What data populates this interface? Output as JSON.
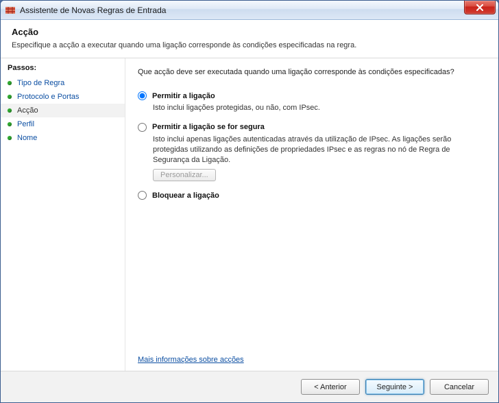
{
  "window": {
    "title": "Assistente de Novas Regras de Entrada"
  },
  "header": {
    "title": "Acção",
    "subtitle": "Especifique a acção a executar quando uma ligação corresponde às condições especificadas na regra."
  },
  "sidebar": {
    "title": "Passos:",
    "items": [
      {
        "label": "Tipo de Regra",
        "current": false
      },
      {
        "label": "Protocolo e Portas",
        "current": false
      },
      {
        "label": "Acção",
        "current": true
      },
      {
        "label": "Perfil",
        "current": false
      },
      {
        "label": "Nome",
        "current": false
      }
    ]
  },
  "content": {
    "prompt": "Que acção deve ser executada quando uma ligação corresponde às condições especificadas?",
    "options": [
      {
        "label": "Permitir a ligação",
        "desc": "Isto inclui ligações protegidas, ou não, com IPsec.",
        "selected": true
      },
      {
        "label": "Permitir a ligação se for segura",
        "desc": "Isto inclui apenas ligações autenticadas através da utilização de IPsec. As ligações serão protegidas utilizando as definições de propriedades IPsec e as regras no nó de Regra de Segurança da Ligação.",
        "selected": false,
        "customize": "Personalizar..."
      },
      {
        "label": "Bloquear a ligação",
        "desc": "",
        "selected": false
      }
    ],
    "learn_more": "Mais informações sobre acções"
  },
  "footer": {
    "back": "< Anterior",
    "next": "Seguinte >",
    "cancel": "Cancelar"
  }
}
